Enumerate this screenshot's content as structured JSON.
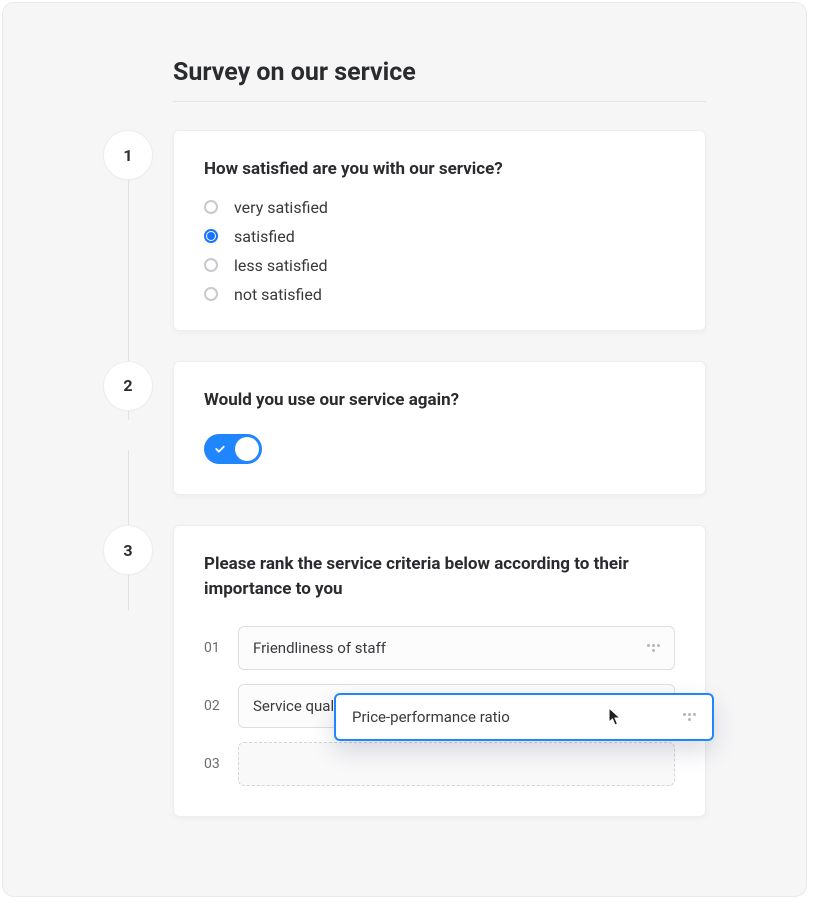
{
  "title": "Survey on our service",
  "steps": {
    "s1": {
      "num": "1",
      "question": "How satisfied are you with our service?",
      "options": {
        "o1": "very satisfied",
        "o2": "satisfied",
        "o3": "less satisfied",
        "o4": "not satisfied"
      },
      "selected": "o2"
    },
    "s2": {
      "num": "2",
      "question": "Would you use our service again?",
      "value": true
    },
    "s3": {
      "num": "3",
      "question": "Please rank the service criteria below according to their importance to you",
      "rows": {
        "r1": {
          "num": "01",
          "label": "Friendliness of staff"
        },
        "r2": {
          "num": "02",
          "label": "Service qualit"
        },
        "r3": {
          "num": "03",
          "label": ""
        }
      },
      "dragging": {
        "label": "Price-performance ratio"
      }
    }
  },
  "colors": {
    "accent": "#1f86ff"
  }
}
